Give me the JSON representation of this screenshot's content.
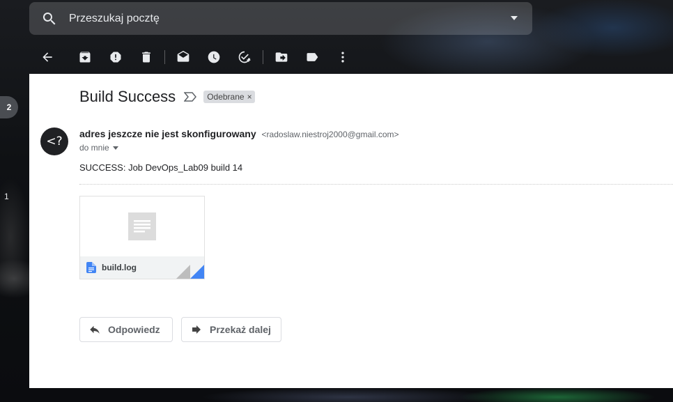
{
  "search": {
    "placeholder": "Przeszukaj pocztę"
  },
  "toolbar": {
    "items": [
      "back-icon",
      "archive-icon",
      "report-spam-icon",
      "delete-icon",
      "mark-unread-icon",
      "snooze-icon",
      "add-task-icon",
      "move-to-icon",
      "labels-icon",
      "more-icon"
    ]
  },
  "side": {
    "badge_count": "2",
    "count_secondary": "1"
  },
  "email": {
    "subject": "Build Success",
    "label": "Odebrane",
    "label_close": "×",
    "avatar_text": "<?",
    "sender_name": "adres jeszcze nie jest skonfigurowany",
    "sender_email": "<radoslaw.niestroj2000@gmail.com>",
    "to": "do mnie",
    "body": "SUCCESS: Job DevOps_Lab09 build 14"
  },
  "attachment": {
    "name": "build.log"
  },
  "actions": {
    "reply": "Odpowiedz",
    "forward": "Przekaż dalej"
  },
  "colors": {
    "accent_blue": "#1a73e8",
    "panel": "#ffffff"
  }
}
